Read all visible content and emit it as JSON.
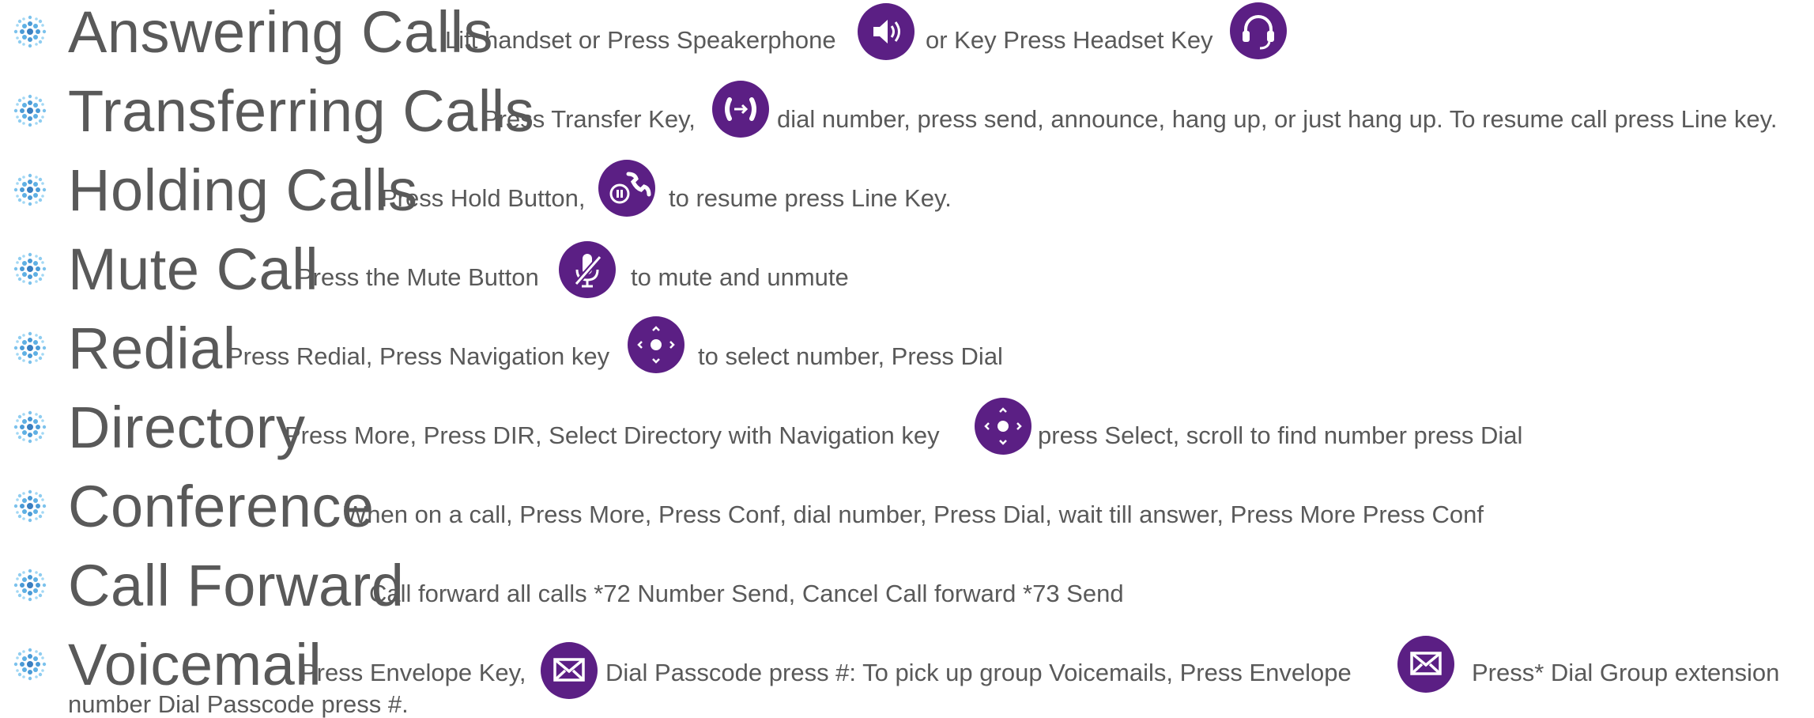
{
  "accent_color": "#5b1f84",
  "text_color": "#595959",
  "items": [
    {
      "title": "Answering Calls",
      "d1": "Lift handset or Press Speakerphone",
      "d2": "or Key Press Headset Key",
      "icons": [
        "speaker-icon",
        "headset-icon"
      ]
    },
    {
      "title": "Transferring Calls",
      "d1": "Press Transfer Key,",
      "d2": "dial number, press send, announce, hang up, or just hang up. To resume call press Line key.",
      "icons": [
        "transfer-icon"
      ]
    },
    {
      "title": "Holding Calls",
      "d1": "Press Hold Button,",
      "d2": "to resume press Line Key.",
      "icons": [
        "hold-icon"
      ]
    },
    {
      "title": "Mute Call",
      "d1": "Press the Mute Button",
      "d2": "to mute and unmute",
      "icons": [
        "mute-microphone-icon"
      ]
    },
    {
      "title": "Redial",
      "d1": "Press Redial, Press Navigation key",
      "d2": "to select number, Press Dial",
      "icons": [
        "navigation-key-icon"
      ]
    },
    {
      "title": "Directory",
      "d1": "Press More, Press DIR, Select Directory with Navigation key",
      "d2": "press Select, scroll to find number press Dial",
      "icons": [
        "navigation-key-icon"
      ]
    },
    {
      "title": "Conference",
      "d1": "When on a call, Press More, Press Conf, dial number, Press Dial, wait till answer, Press More Press Conf",
      "icons": []
    },
    {
      "title": "Call Forward",
      "d1": "Call forward all calls *72 Number Send, Cancel Call forward *73 Send",
      "icons": []
    },
    {
      "title": "Voicemail",
      "d1": "Press Envelope Key,",
      "d2": "Dial Passcode press #:  To pick up group Voicemails, Press Envelope",
      "d3": "Press* Dial Group extension",
      "d4": "number Dial Passcode press #.",
      "icons": [
        "envelope-icon",
        "envelope-icon"
      ]
    }
  ]
}
